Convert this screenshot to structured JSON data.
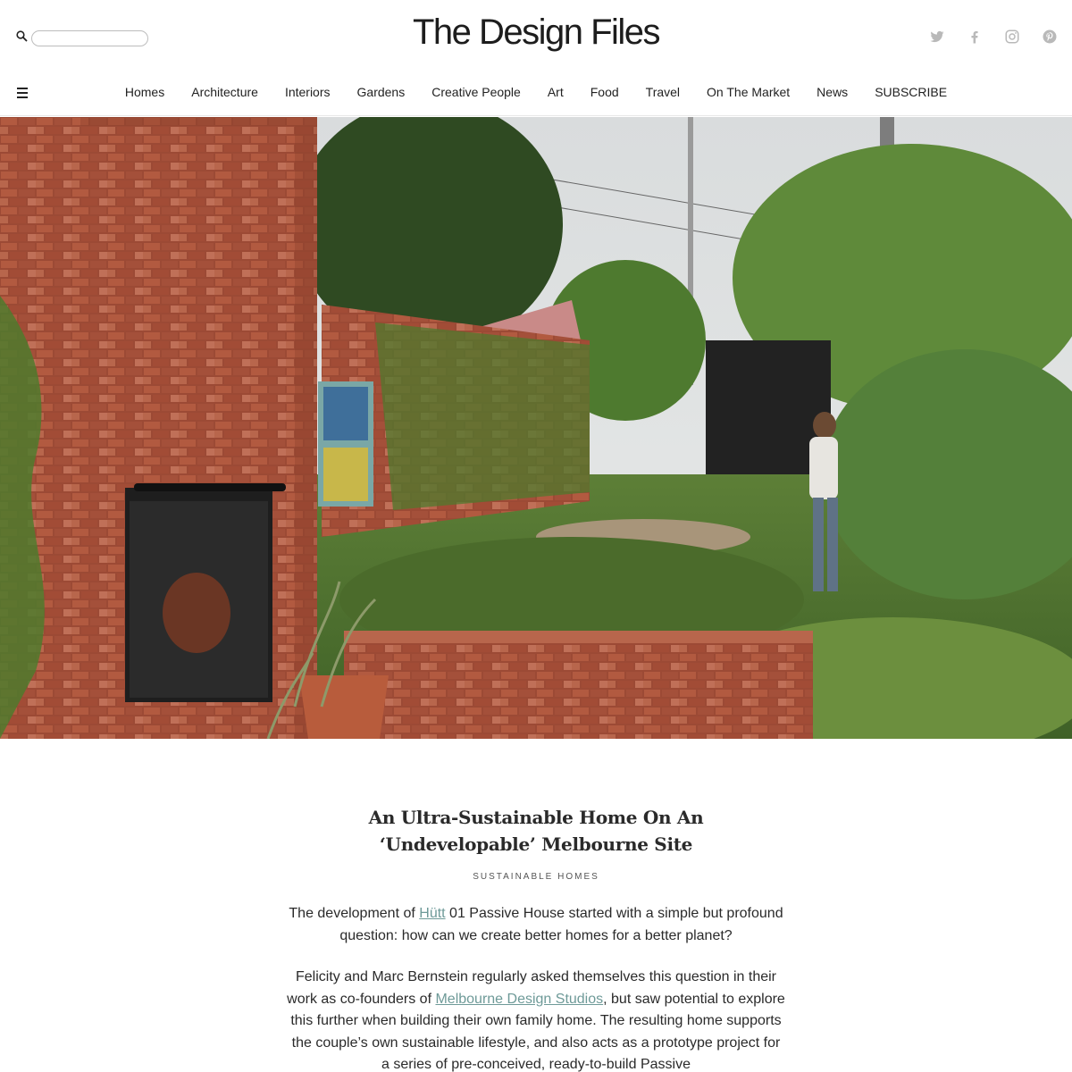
{
  "header": {
    "logo": "The Design Files",
    "search_placeholder": "",
    "social": [
      {
        "name": "twitter-icon"
      },
      {
        "name": "facebook-icon"
      },
      {
        "name": "instagram-icon"
      },
      {
        "name": "pinterest-icon"
      }
    ]
  },
  "nav": {
    "items": [
      "Homes",
      "Architecture",
      "Interiors",
      "Gardens",
      "Creative People",
      "Art",
      "Food",
      "Travel",
      "On The Market",
      "News",
      "SUBSCRIBE"
    ]
  },
  "article": {
    "title": "An Ultra-Sustainable Home On An ‘Undevelopable’ Melbourne Site",
    "category": "SUSTAINABLE HOMES",
    "p1": {
      "before": "The development of ",
      "link": "Hütt",
      "after": " 01 Passive House started with a simple but profound question: how can we create better homes for a better planet?"
    },
    "p2": {
      "before": "Felicity and Marc Bernstein regularly asked themselves this question in their work as co-founders of ",
      "link": "Melbourne Design Studios",
      "after": ", but saw potential to explore this further when building their own family home. The resulting home supports the couple’s own sustainable lifestyle, and also acts as a prototype project for a series of pre-conceived, ready-to-build Passive"
    }
  },
  "colors": {
    "link": "#6e9a98",
    "text": "#2a2a2a",
    "brick": "#a8533c"
  }
}
